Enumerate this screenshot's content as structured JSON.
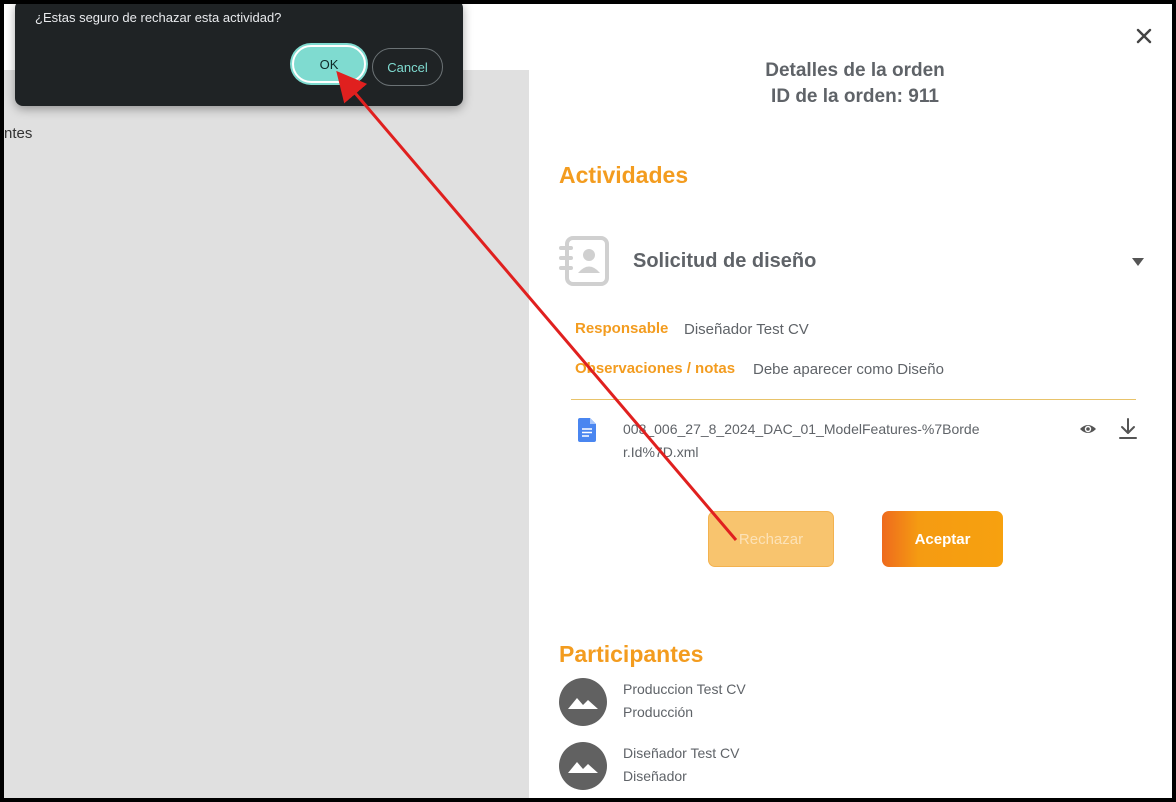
{
  "dialog": {
    "message": "¿Estas seguro de rechazar esta actividad?",
    "ok_label": "OK",
    "cancel_label": "Cancel"
  },
  "background": {
    "partial_text": "ntes"
  },
  "order": {
    "title": "Detalles de la orden",
    "id_line": "ID de la orden: 911"
  },
  "activities": {
    "section_title": "Actividades",
    "item": {
      "name": "Solicitud de diseño",
      "responsible_label": "Responsable",
      "responsible_value": "Diseñador Test CV",
      "notes_label": "Observaciones / notas",
      "notes_value": "Debe aparecer como Diseño",
      "file_name": "008_006_27_8_2024_DAC_01_ModelFeatures-%7Border.Id%7D.xml",
      "reject_label": "Rechazar",
      "accept_label": "Aceptar"
    }
  },
  "participants": {
    "section_title": "Participantes",
    "items": [
      {
        "name": "Produccion Test CV",
        "role": "Producción"
      },
      {
        "name": "Diseñador Test CV",
        "role": "Diseñador"
      }
    ]
  },
  "colors": {
    "accent_orange": "#f39c1f",
    "dialog_bg": "#1f2325",
    "teal": "#7fdbd0",
    "annotation_arrow": "#e0201f"
  },
  "icons": [
    "close-icon",
    "document-contact-icon",
    "caret-down-icon",
    "file-doc-icon",
    "eye-icon",
    "download-icon",
    "image-placeholder-icon"
  ]
}
